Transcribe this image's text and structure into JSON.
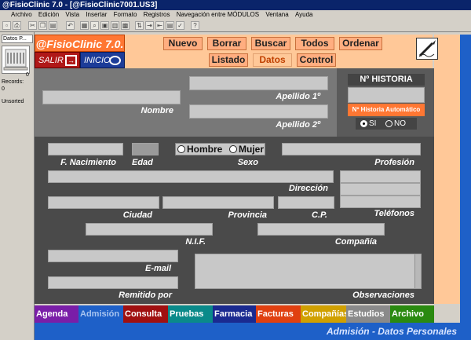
{
  "window": {
    "title": "@FisioClinic 7.0 - [@FisioClinic7001.US3]"
  },
  "menu": [
    "Archivo",
    "Edición",
    "Vista",
    "Insertar",
    "Formato",
    "Registros",
    "Navegación entre MÓDULOS",
    "Ventana",
    "Ayuda"
  ],
  "left_panel": {
    "dropdown": "Datos P...",
    "count_value": "0",
    "records_label": "Records:",
    "records_value": "0",
    "sort_label": "Unsorted"
  },
  "header": {
    "logo": "@FisioClinic 7.0.",
    "salir": "SALIR",
    "inicio": "INICIO",
    "actions": [
      "Nuevo",
      "Borrar",
      "Buscar",
      "Todos",
      "Ordenar"
    ],
    "views": [
      "Listado",
      "Datos",
      "Control"
    ],
    "active_view": "Datos"
  },
  "form": {
    "nombre_label": "Nombre",
    "apellido1_label": "Apellido 1º",
    "apellido2_label": "Apellido 2º",
    "historia_title": "Nº HISTORIA",
    "historia_auto": "Nº Historia Automático",
    "si_label": "SI",
    "no_label": "NO",
    "nacimiento_label": "F. Nacimiento",
    "edad_label": "Edad",
    "hombre_label": "Hombre",
    "mujer_label": "Mujer",
    "sexo_label": "Sexo",
    "profesion_label": "Profesión",
    "direccion_label": "Dirección",
    "telefonos_label": "Teléfonos",
    "ciudad_label": "Ciudad",
    "provincia_label": "Provincia",
    "cp_label": "C.P.",
    "nif_label": "N.I.F.",
    "compania_label": "Compañía",
    "email_label": "E-mail",
    "remitido_label": "Remitido por",
    "observaciones_label": "Observaciones"
  },
  "tabs": [
    {
      "label": "Agenda",
      "color": "#7a1ea8"
    },
    {
      "label": "Admisión",
      "color": "#1e60c8"
    },
    {
      "label": "Consulta",
      "color": "#a01010"
    },
    {
      "label": "Pruebas",
      "color": "#0a8a8a"
    },
    {
      "label": "Farmacia",
      "color": "#1a2a90"
    },
    {
      "label": "Facturas",
      "color": "#e04010"
    },
    {
      "label": "Compañías",
      "color": "#d0a000"
    },
    {
      "label": "Estudios",
      "color": "#8a8a8a"
    },
    {
      "label": "Archivo",
      "color": "#2a8a10"
    }
  ],
  "status": "Admisión - Datos Personales"
}
